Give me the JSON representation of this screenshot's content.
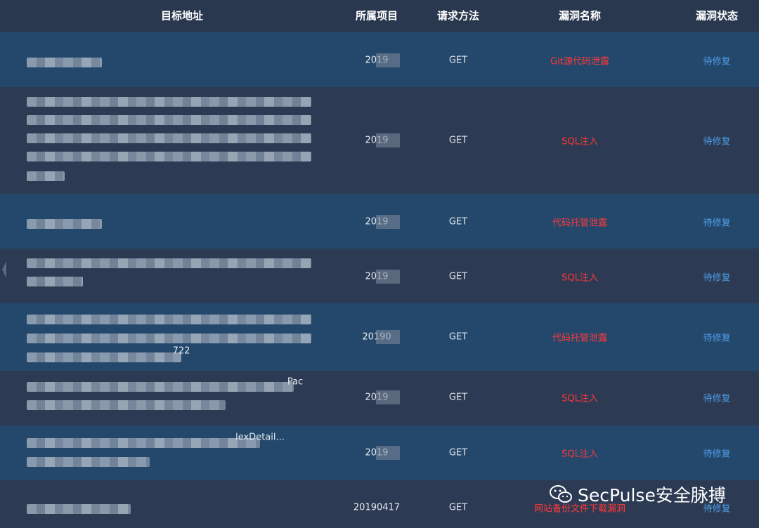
{
  "header": {
    "target": "目标地址",
    "project": "所属项目",
    "method": "请求方法",
    "vuln_name": "漏洞名称",
    "status": "漏洞状态"
  },
  "rows": [
    {
      "project": "2019",
      "method": "GET",
      "vuln": "Git源代码泄露",
      "status": "待修复",
      "target_suffix": ""
    },
    {
      "project": "2019",
      "method": "GET",
      "vuln": "SQL注入",
      "status": "待修复",
      "target_suffix": ""
    },
    {
      "project": "2019",
      "method": "GET",
      "vuln": "代码托管泄露",
      "status": "待修复",
      "target_suffix": ""
    },
    {
      "project": "2019",
      "method": "GET",
      "vuln": "SQL注入",
      "status": "待修复",
      "target_suffix": ""
    },
    {
      "project": "20190",
      "method": "GET",
      "vuln": "代码托管泄露",
      "status": "待修复",
      "target_suffix": "722"
    },
    {
      "project": "2019",
      "method": "GET",
      "vuln": "SQL注入",
      "status": "待修复",
      "target_suffix": "Pac"
    },
    {
      "project": "2019",
      "method": "GET",
      "vuln": "SQL注入",
      "status": "待修复",
      "target_suffix": "lexDetail..."
    },
    {
      "project": "20190417",
      "method": "GET",
      "vuln": "网站备份文件下载漏洞",
      "status": "待修复",
      "target_suffix": ""
    }
  ],
  "watermark": {
    "text": "SecPulse安全脉搏",
    "icon": "wechat-icon"
  },
  "colors": {
    "vuln": "#ff3838",
    "status": "#4f9eea",
    "row_blue": "#24486c",
    "row_dark": "#2c3b53"
  }
}
